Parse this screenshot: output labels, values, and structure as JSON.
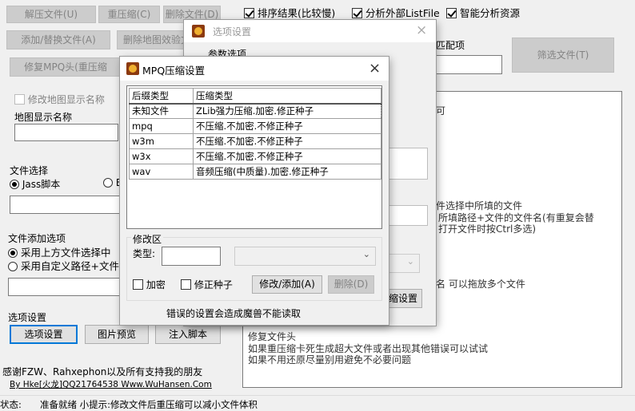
{
  "main": {
    "buttons": {
      "extract": "解压文件(U)",
      "recompress": "重压缩(C)",
      "delete": "删除文件(D)",
      "add_replace": "添加/替换文件(A)",
      "delete_map_check": "删除地图效验文",
      "repair_mpq": "修复MPQ头(重压缩",
      "filter_files": "筛选文件(T)",
      "option_settings": "选项设置",
      "image_preview": "图片预览",
      "inject_script": "注入脚本"
    },
    "top_checks": {
      "sort_result": "排序结果(比较慢)",
      "analyze_external": "分析外部ListFile",
      "smart_analyze": "智能分析资源"
    },
    "match_label": "匹配项",
    "modify_map_name": "修改地图显示名称",
    "map_display_name": "地图显示名称",
    "file_select": "文件选择",
    "radio_jass": "Jass脚本",
    "radio_e_partial": "E",
    "file_add_options": "文件添加选项",
    "radio_use_above": "采用上方文件选择中",
    "radio_use_custom": "采用自定义路径+文件",
    "option_settings_label": "选项设置",
    "thanks": "感谢FZW、Rahxephon以及所有支持我的朋友",
    "credit_link": "By Hke[火龙]QQ21764538 Www.WuHansen.Com",
    "log_lines": {
      "l1": "可",
      "l2": "件选择中所填的文件",
      "l3": "所填路径+文件的文件名(有重复会替",
      "l4": "打开文件时按Ctrl多选)",
      "l5": "名 可以拖放多个文件",
      "l6": "修复文件头",
      "l7": "如果重压缩卡死生成超大文件或者出现其他错误可以试试",
      "l8": "如果不用还原尽量别用避免不必要问题"
    },
    "status_label": "状态:",
    "status_text": "准备就绪 小提示:修改文件后重压缩可以减小文件体积"
  },
  "options_dialog": {
    "title": "选项设置",
    "params_label": "参数选项",
    "partial_button": "缩设置"
  },
  "mpq_dialog": {
    "title": "MPQ压缩设置",
    "headers": [
      "后缀类型",
      "压缩类型"
    ],
    "rows": [
      [
        "未知文件",
        "ZLib强力压缩.加密.修正种子"
      ],
      [
        "mpq",
        "不压缩.不加密.不修正种子"
      ],
      [
        "w3m",
        "不压缩.不加密.不修正种子"
      ],
      [
        "w3x",
        "不压缩.不加密.不修正种子"
      ],
      [
        "wav",
        "音频压缩(中质量).加密.修正种子"
      ]
    ],
    "modify_area": "修改区",
    "type_label": "类型:",
    "encrypt_label": "加密",
    "fix_seed_label": "修正种子",
    "modify_add_button": "修改/添加(A)",
    "delete_button": "删除(D)",
    "warning": "错误的设置会造成魔兽不能读取"
  },
  "icons": {
    "close": "close-icon",
    "app": "warcraft-icon",
    "dropdown": "chevron-down-icon"
  }
}
